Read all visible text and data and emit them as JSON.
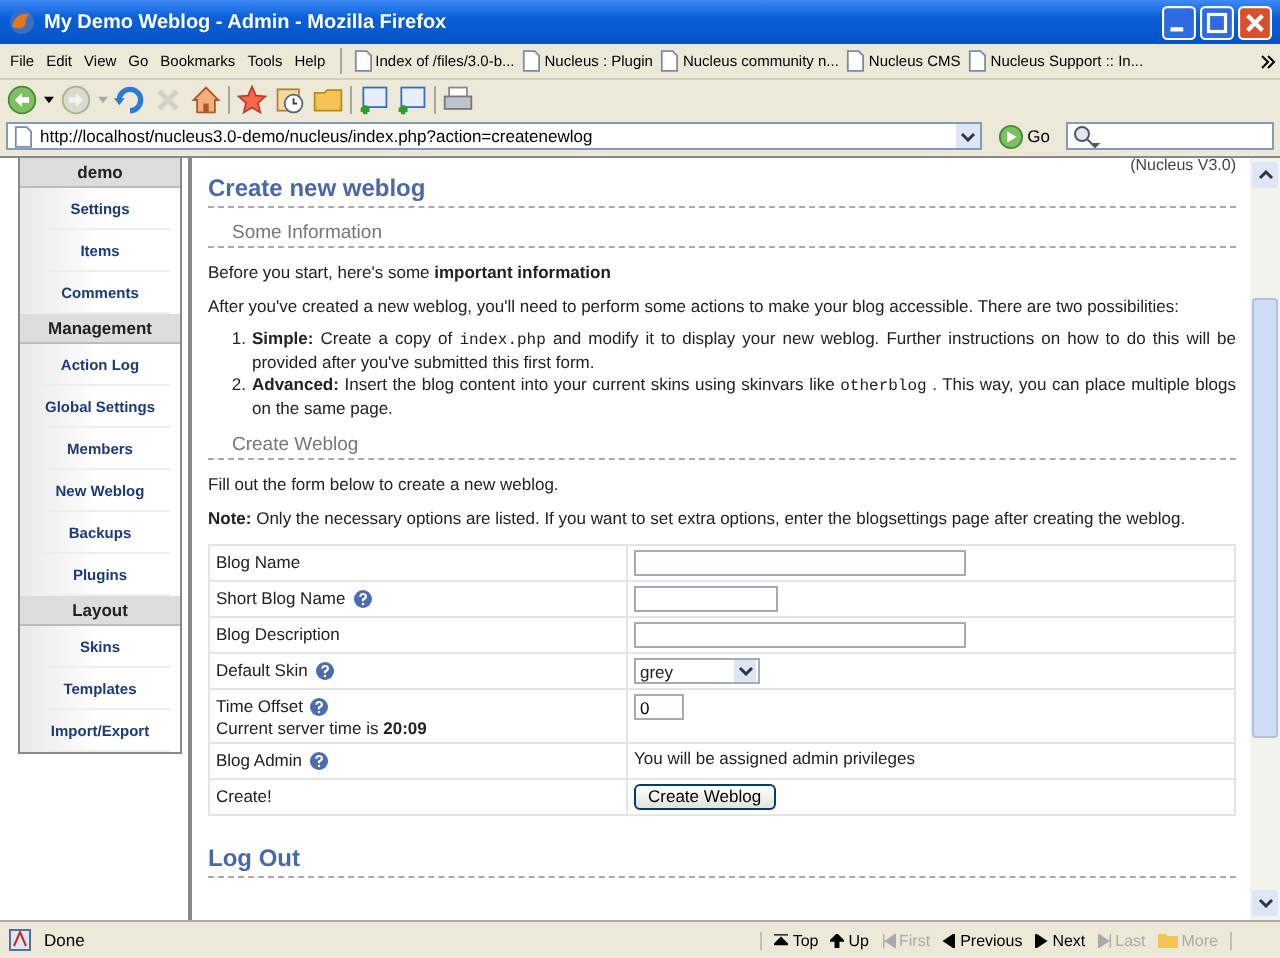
{
  "window": {
    "title": "My Demo Weblog - Admin - Mozilla Firefox"
  },
  "menu": [
    "File",
    "Edit",
    "View",
    "Go",
    "Bookmarks",
    "Tools",
    "Help"
  ],
  "bookmarks": [
    "Index of /files/3.0-b...",
    "Nucleus : Plugin",
    "Nucleus community n...",
    "Nucleus CMS",
    "Nucleus Support :: In..."
  ],
  "toolbar": [
    {
      "kind": "back",
      "disabled": false
    },
    {
      "kind": "forward",
      "disabled": true
    },
    {
      "kind": "reload",
      "disabled": false
    },
    {
      "kind": "stop",
      "disabled": true
    },
    {
      "kind": "home",
      "disabled": false
    },
    {
      "kind": "bookmark",
      "disabled": false
    },
    {
      "kind": "history",
      "disabled": false
    },
    {
      "kind": "folder",
      "disabled": false
    },
    {
      "kind": "newtab",
      "disabled": false
    },
    {
      "kind": "newwindow",
      "disabled": false
    },
    {
      "kind": "print",
      "disabled": false
    }
  ],
  "address": {
    "url": "http://localhost/nucleus3.0-demo/nucleus/index.php?action=createnewlog",
    "go": "Go"
  },
  "sidebar": [
    {
      "heading": "demo",
      "items": [
        "Settings",
        "Items",
        "Comments"
      ]
    },
    {
      "heading": "Management",
      "items": [
        "Action Log",
        "Global Settings",
        "Members",
        "New Weblog",
        "Backups",
        "Plugins"
      ]
    },
    {
      "heading": "Layout",
      "items": [
        "Skins",
        "Templates",
        "Import/Export"
      ]
    }
  ],
  "page": {
    "version": "(Nucleus V3.0)",
    "title": "Create new weblog",
    "info_heading": "Some Information",
    "intro": "Before you start, here's some **important information**",
    "after": "After you've created a new weblog, you'll need to perform some actions to make your blog accessible. There are two possibilities:",
    "options": [
      {
        "marker": "1.",
        "label": "Simple:",
        "text": "Create a copy of",
        "code": "index.php",
        "rest": "and modify it to display your new weblog. Further instructions on how to do this will be provided after you've submitted this first form."
      },
      {
        "marker": "2.",
        "label": "Advanced:",
        "text": "Insert the blog content into your current skins using skinvars like",
        "code": "otherblog",
        "rest": ". This way, you can place multiple blogs on the same page."
      }
    ],
    "form_heading": "Create Weblog",
    "fill": "Fill out the form below to create a new weblog.",
    "note_label": "Note:",
    "note": "Only the necessary options are listed. If you want to set extra options, enter the blogsettings page after creating the weblog.",
    "rows": [
      {
        "label": "Blog Name",
        "help": false,
        "kind": "wide"
      },
      {
        "label": "Short Blog Name",
        "help": true,
        "kind": "short"
      },
      {
        "label": "Blog Description",
        "help": false,
        "kind": "wide"
      },
      {
        "label": "Default Skin",
        "help": true,
        "kind": "select",
        "value": "grey"
      },
      {
        "label": "Time Offset",
        "help": true,
        "kind": "tiny",
        "value": "0",
        "sub": "Current server time is **20:09**"
      },
      {
        "label": "Blog Admin",
        "help": true,
        "kind": "static",
        "value": "You will be assigned admin privileges"
      },
      {
        "label": "Create!",
        "help": false,
        "kind": "button",
        "value": "Create Weblog"
      }
    ],
    "logout": "Log Out"
  },
  "status": {
    "text": "Done",
    "nav": [
      {
        "kind": "top",
        "label": "Top",
        "disabled": false
      },
      {
        "kind": "up",
        "label": "Up",
        "disabled": false
      },
      {
        "kind": "first",
        "label": "First",
        "disabled": true
      },
      {
        "kind": "previous",
        "label": "Previous",
        "disabled": false
      },
      {
        "kind": "next",
        "label": "Next",
        "disabled": false
      },
      {
        "kind": "last",
        "label": "Last",
        "disabled": true
      },
      {
        "kind": "more",
        "label": "More",
        "disabled": true
      }
    ]
  }
}
